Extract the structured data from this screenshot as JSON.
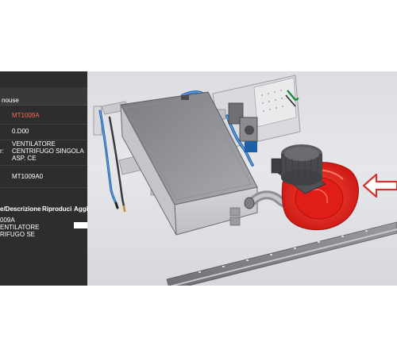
{
  "panel": {
    "header": "nouse",
    "rows": [
      {
        "value": "MT1009A",
        "color": "#ff6b57"
      },
      {
        "value": "0.D00",
        "color": "#ffffff"
      },
      {
        "label": "r:",
        "value_line1": "VENTILATORE",
        "value_line2": "CENTRIFUGO SINGOLA",
        "value_line3": "ASP. CE",
        "color": "#ffffff"
      },
      {
        "value": "MT1009A0",
        "color": "#ffffff"
      }
    ],
    "tabs": [
      "e/Descrizione",
      "Riproduci",
      "Aggi"
    ],
    "list": {
      "code": "009A",
      "line1": "ENTILATORE",
      "line2": "RIFUGO SE"
    }
  },
  "viewport": {
    "highlight_color": "#ee2222",
    "arrow_color": "#d9312b",
    "arrow_icon": "arrow-left-outline-icon"
  }
}
